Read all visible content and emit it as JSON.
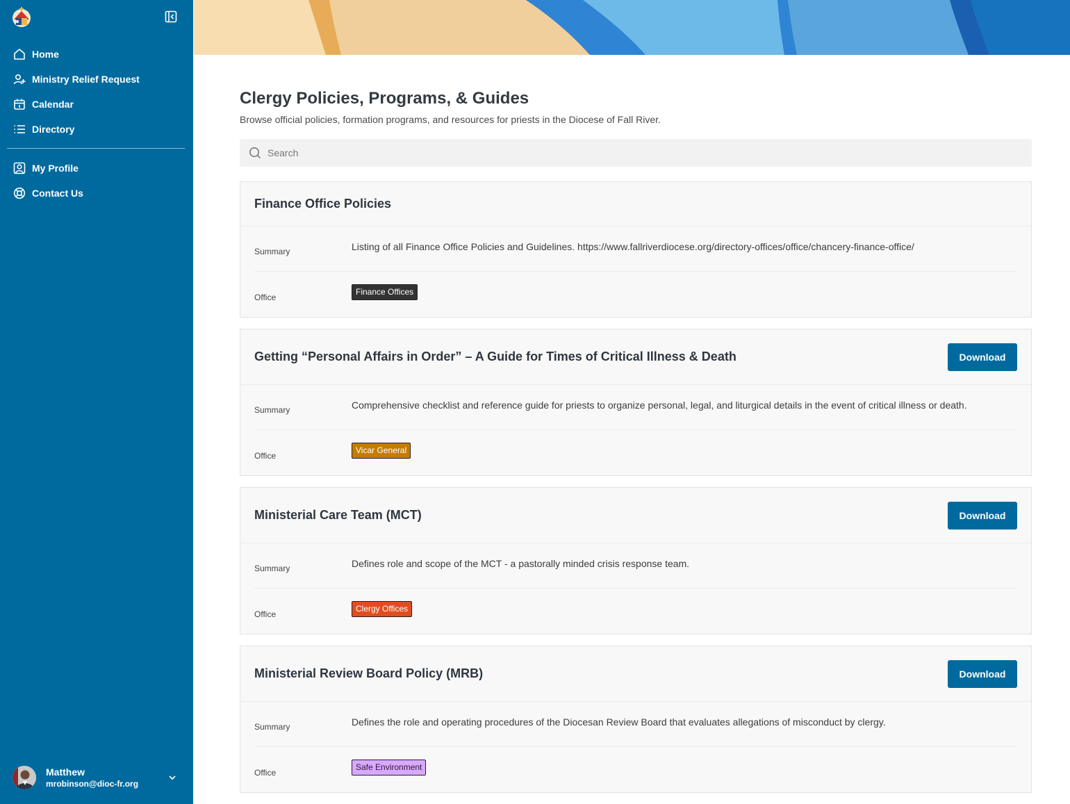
{
  "sidebar": {
    "nav": [
      {
        "label": "Home",
        "icon": "home-icon"
      },
      {
        "label": "Ministry Relief Request",
        "icon": "user-plus-icon"
      },
      {
        "label": "Calendar",
        "icon": "calendar-icon"
      },
      {
        "label": "Directory",
        "icon": "list-icon"
      }
    ],
    "nav2": [
      {
        "label": "My Profile",
        "icon": "profile-icon"
      },
      {
        "label": "Contact Us",
        "icon": "lifebuoy-icon"
      }
    ],
    "user": {
      "name": "Matthew",
      "email": "mrobinson@dioc-fr.org"
    }
  },
  "page": {
    "title": "Clergy Policies, Programs, & Guides",
    "subtitle": "Browse official policies, formation programs, and resources for priests in the Diocese of Fall River."
  },
  "search": {
    "placeholder": "Search"
  },
  "labels": {
    "summary": "Summary",
    "office": "Office",
    "download": "Download"
  },
  "cards": [
    {
      "title": "Finance Office Policies",
      "summary": "Listing of all Finance Office Policies and Guidelines. https://www.fallriverdiocese.org/directory-offices/office/chancery-finance-office/",
      "office": "Finance Offices",
      "has_download": false,
      "tag_bg": "#333333",
      "tag_fg": "#ffffff"
    },
    {
      "title": "Getting “Personal Affairs in Order” – A Guide for Times of Critical Illness & Death",
      "summary": "Comprehensive checklist and reference guide for priests to organize personal, legal, and liturgical details in the event of critical illness or death.",
      "office": "Vicar General",
      "has_download": true,
      "tag_bg": "#c57c00",
      "tag_fg": "#ffffff"
    },
    {
      "title": "Ministerial Care Team (MCT)",
      "summary": "Defines role and scope of the MCT - a pastorally minded crisis response team.",
      "office": "Clergy Offices",
      "has_download": true,
      "tag_bg": "#e04e1f",
      "tag_fg": "#ffffff"
    },
    {
      "title": "Ministerial Review Board Policy (MRB)",
      "summary": "Defines the role and operating procedures of the Diocesan Review Board that evaluates allegations of misconduct by clergy.",
      "office": "Safe Environment",
      "has_download": true,
      "tag_bg": "#d9a8ff",
      "tag_fg": "#2b1b3a"
    }
  ],
  "colors": {
    "sidebar": "#006a9e",
    "accent": "#006a9e"
  }
}
